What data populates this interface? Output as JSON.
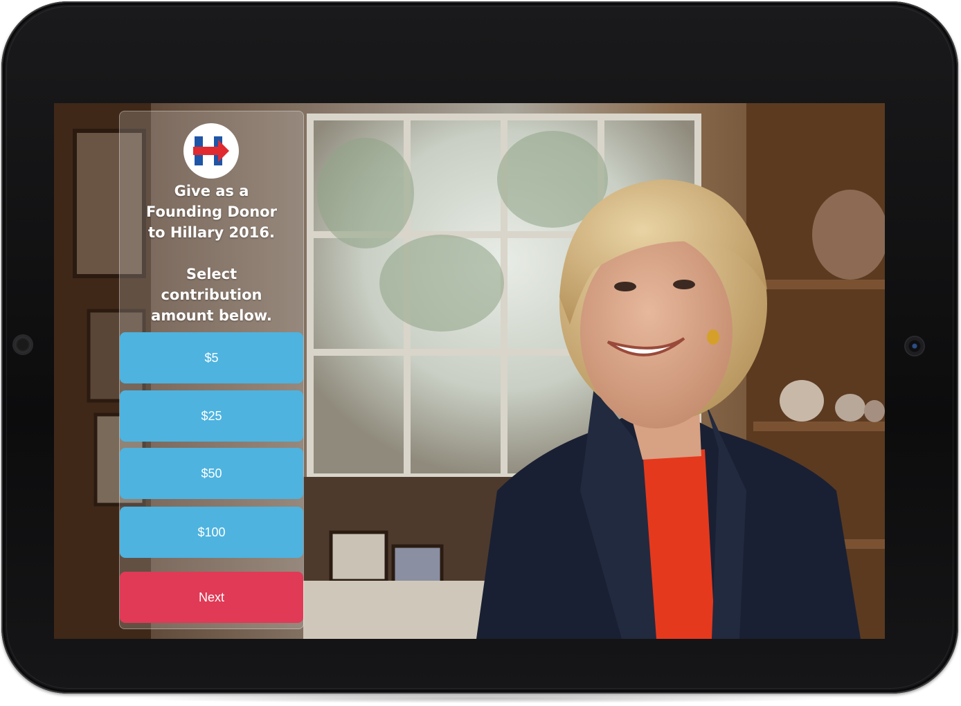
{
  "app": {
    "colors": {
      "amount_button": "#4eb3df",
      "next_button": "#e03a56",
      "logo_blue": "#1f55a6",
      "logo_red": "#e02a2f"
    }
  },
  "panel": {
    "logo_icon": "hillary-h-arrow-logo",
    "heading_lines": [
      "Give as a",
      "Founding Donor",
      "to Hillary 2016."
    ],
    "subheading_lines": [
      "Select",
      "contribution",
      "amount below."
    ],
    "amounts": [
      "$5",
      "$25",
      "$50",
      "$100"
    ],
    "next_label": "Next"
  }
}
